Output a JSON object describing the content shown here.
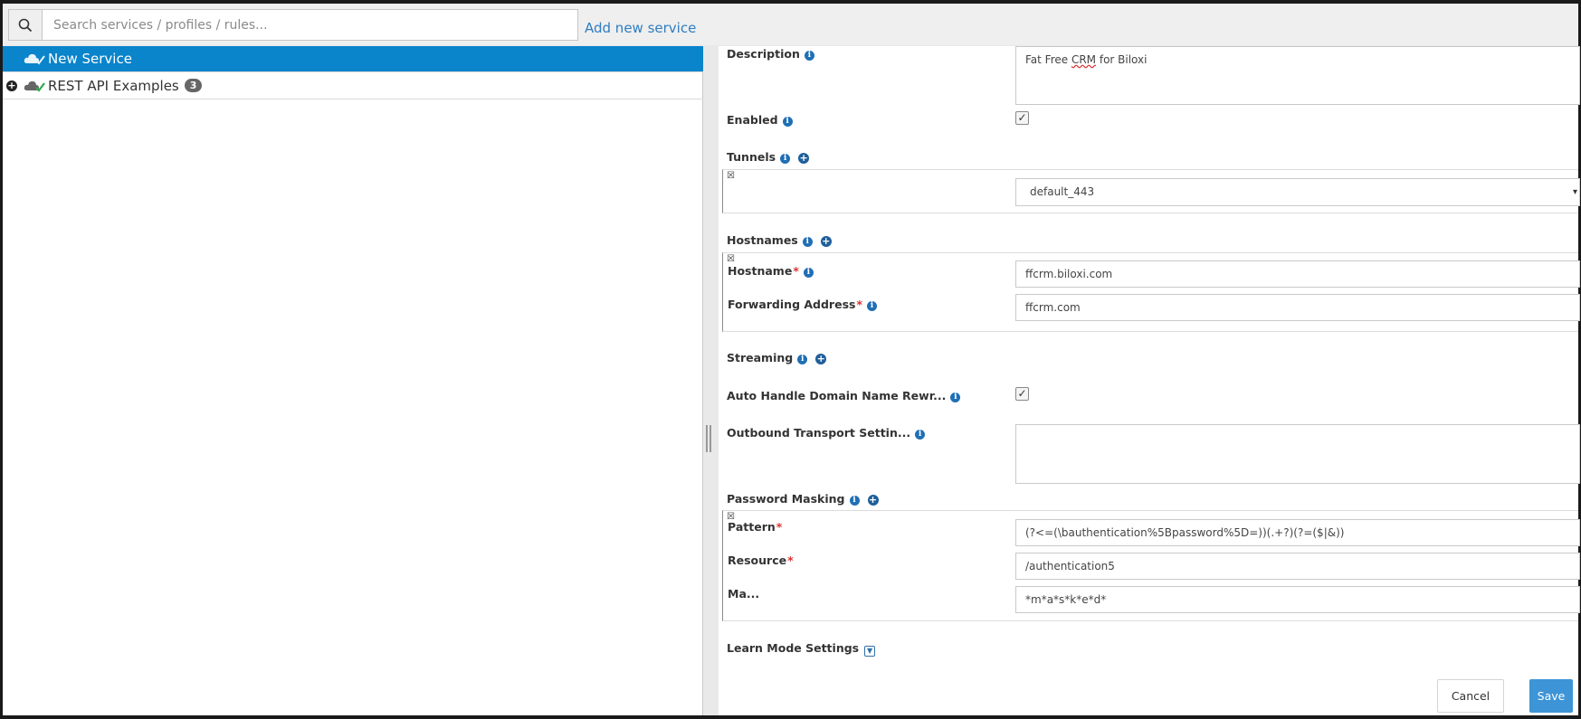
{
  "toolbar": {
    "search_placeholder": "Search services / profiles / rules...",
    "add_link": "Add new service"
  },
  "tree": {
    "items": [
      {
        "label": "New Service",
        "selected": true
      },
      {
        "label": "REST API Examples",
        "count": "3",
        "selected": false
      }
    ]
  },
  "form": {
    "description": {
      "label": "Description",
      "value_pre": "Fat Free ",
      "value_err": "CRM",
      "value_post": " for Biloxi"
    },
    "enabled": {
      "label": "Enabled",
      "checked": true,
      "mark": "✓"
    },
    "tunnels": {
      "label": "Tunnels",
      "remove": "☒",
      "select_value": "default_443",
      "arrow": "▾"
    },
    "hostnames": {
      "label": "Hostnames",
      "remove": "☒",
      "hostname_label": "Hostname",
      "hostname_value": "ffcrm.biloxi.com",
      "forwarding_label": "Forwarding Address",
      "forwarding_value": "ffcrm.com"
    },
    "streaming": {
      "label": "Streaming"
    },
    "auto_handle": {
      "label": "Auto Handle Domain Name Rewr...",
      "checked": true,
      "mark": "✓"
    },
    "outbound": {
      "label": "Outbound Transport Settin...",
      "value": ""
    },
    "password_masking": {
      "label": "Password Masking",
      "remove": "☒",
      "pattern_label": "Pattern",
      "pattern_value": "(?<=(\\bauthentication%5Bpassword%5D=))(.+?)(?=($|&))",
      "resource_label": "Resource",
      "resource_value": "/authentication5",
      "mask_label": "Ma...",
      "mask_value": "*m*a*s*k*e*d*"
    },
    "learn_mode": {
      "label": "Learn Mode Settings",
      "icon": "▼"
    },
    "required_mark": "*",
    "info_glyph": "i",
    "plus_glyph": "+"
  },
  "buttons": {
    "cancel": "Cancel",
    "save": "Save"
  },
  "colors": {
    "selected_row": "#0a84cb",
    "link": "#2f7dc0",
    "save": "#3d94d6",
    "required": "#d33"
  }
}
